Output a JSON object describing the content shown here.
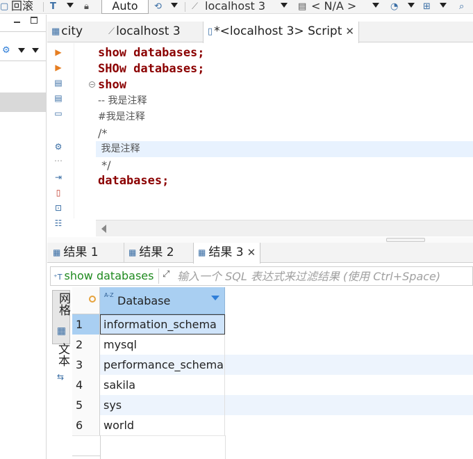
{
  "toolbar": {
    "rollback_label": "回滚",
    "transaction_mode": "Auto",
    "connection": "localhost 3",
    "schema": "< N/A >"
  },
  "editor_tabs": [
    {
      "label": "city"
    },
    {
      "label": "localhost 3"
    },
    {
      "label": "*<localhost 3> Script"
    }
  ],
  "editor": {
    "lines": [
      "show databases;",
      "SHOw databases;",
      "show",
      "-- 我是注释",
      "#我是注释",
      "/*",
      " 我是注释",
      " */",
      "databases;"
    ]
  },
  "result_tabs": [
    {
      "label": "结果 1"
    },
    {
      "label": "结果 2"
    },
    {
      "label": "结果 3"
    }
  ],
  "filter": {
    "query": "show databases",
    "placeholder": "输入一个 SQL 表达式来过滤结果 (使用 Ctrl+Space)"
  },
  "view_switch": {
    "grid_label": "网格",
    "text_label": "文本"
  },
  "grid": {
    "column": "Database",
    "rows": [
      {
        "num": "1",
        "value": "information_schema"
      },
      {
        "num": "2",
        "value": "mysql"
      },
      {
        "num": "3",
        "value": "performance_schema"
      },
      {
        "num": "4",
        "value": "sakila"
      },
      {
        "num": "5",
        "value": "sys"
      },
      {
        "num": "6",
        "value": "world"
      }
    ]
  },
  "colors": {
    "keyword": "#8b0000",
    "column_header": "#a9cff2",
    "selected_cell": "#cfe4fa",
    "alt_row": "#edf4fd",
    "query_text": "#1f8a1f"
  }
}
